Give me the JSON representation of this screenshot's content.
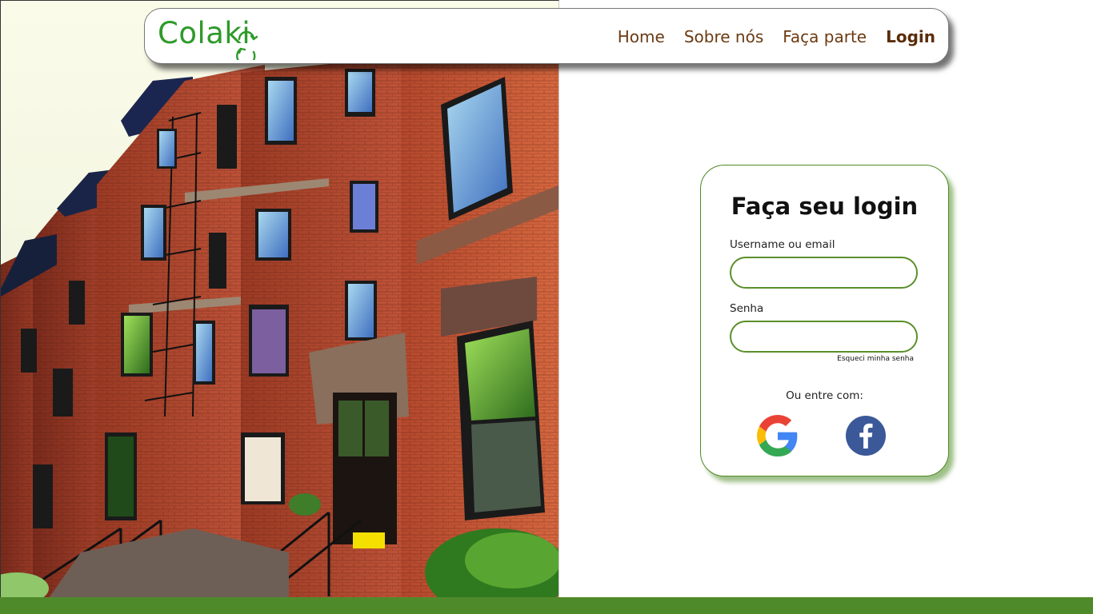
{
  "brand": {
    "name": "Colaki",
    "logo_color": "#2f9a2a"
  },
  "nav": {
    "items": [
      {
        "label": "Home"
      },
      {
        "label": "Sobre nós"
      },
      {
        "label": "Faça parte"
      },
      {
        "label": "Login"
      }
    ],
    "text_color": "#6b3a12"
  },
  "login": {
    "title": "Faça seu login",
    "username_label": "Username ou email",
    "username_value": "",
    "password_label": "Senha",
    "password_value": "",
    "forgot_label": "Esqueci minha senha",
    "alt_label": "Ou entre com:",
    "providers": [
      {
        "icon": "google-icon"
      },
      {
        "icon": "facebook-icon"
      }
    ],
    "accent": "#4f8a2a"
  },
  "hero": {
    "image": "red-brick-townhouses-photo"
  },
  "footer": {
    "color": "#4f8a2a"
  }
}
